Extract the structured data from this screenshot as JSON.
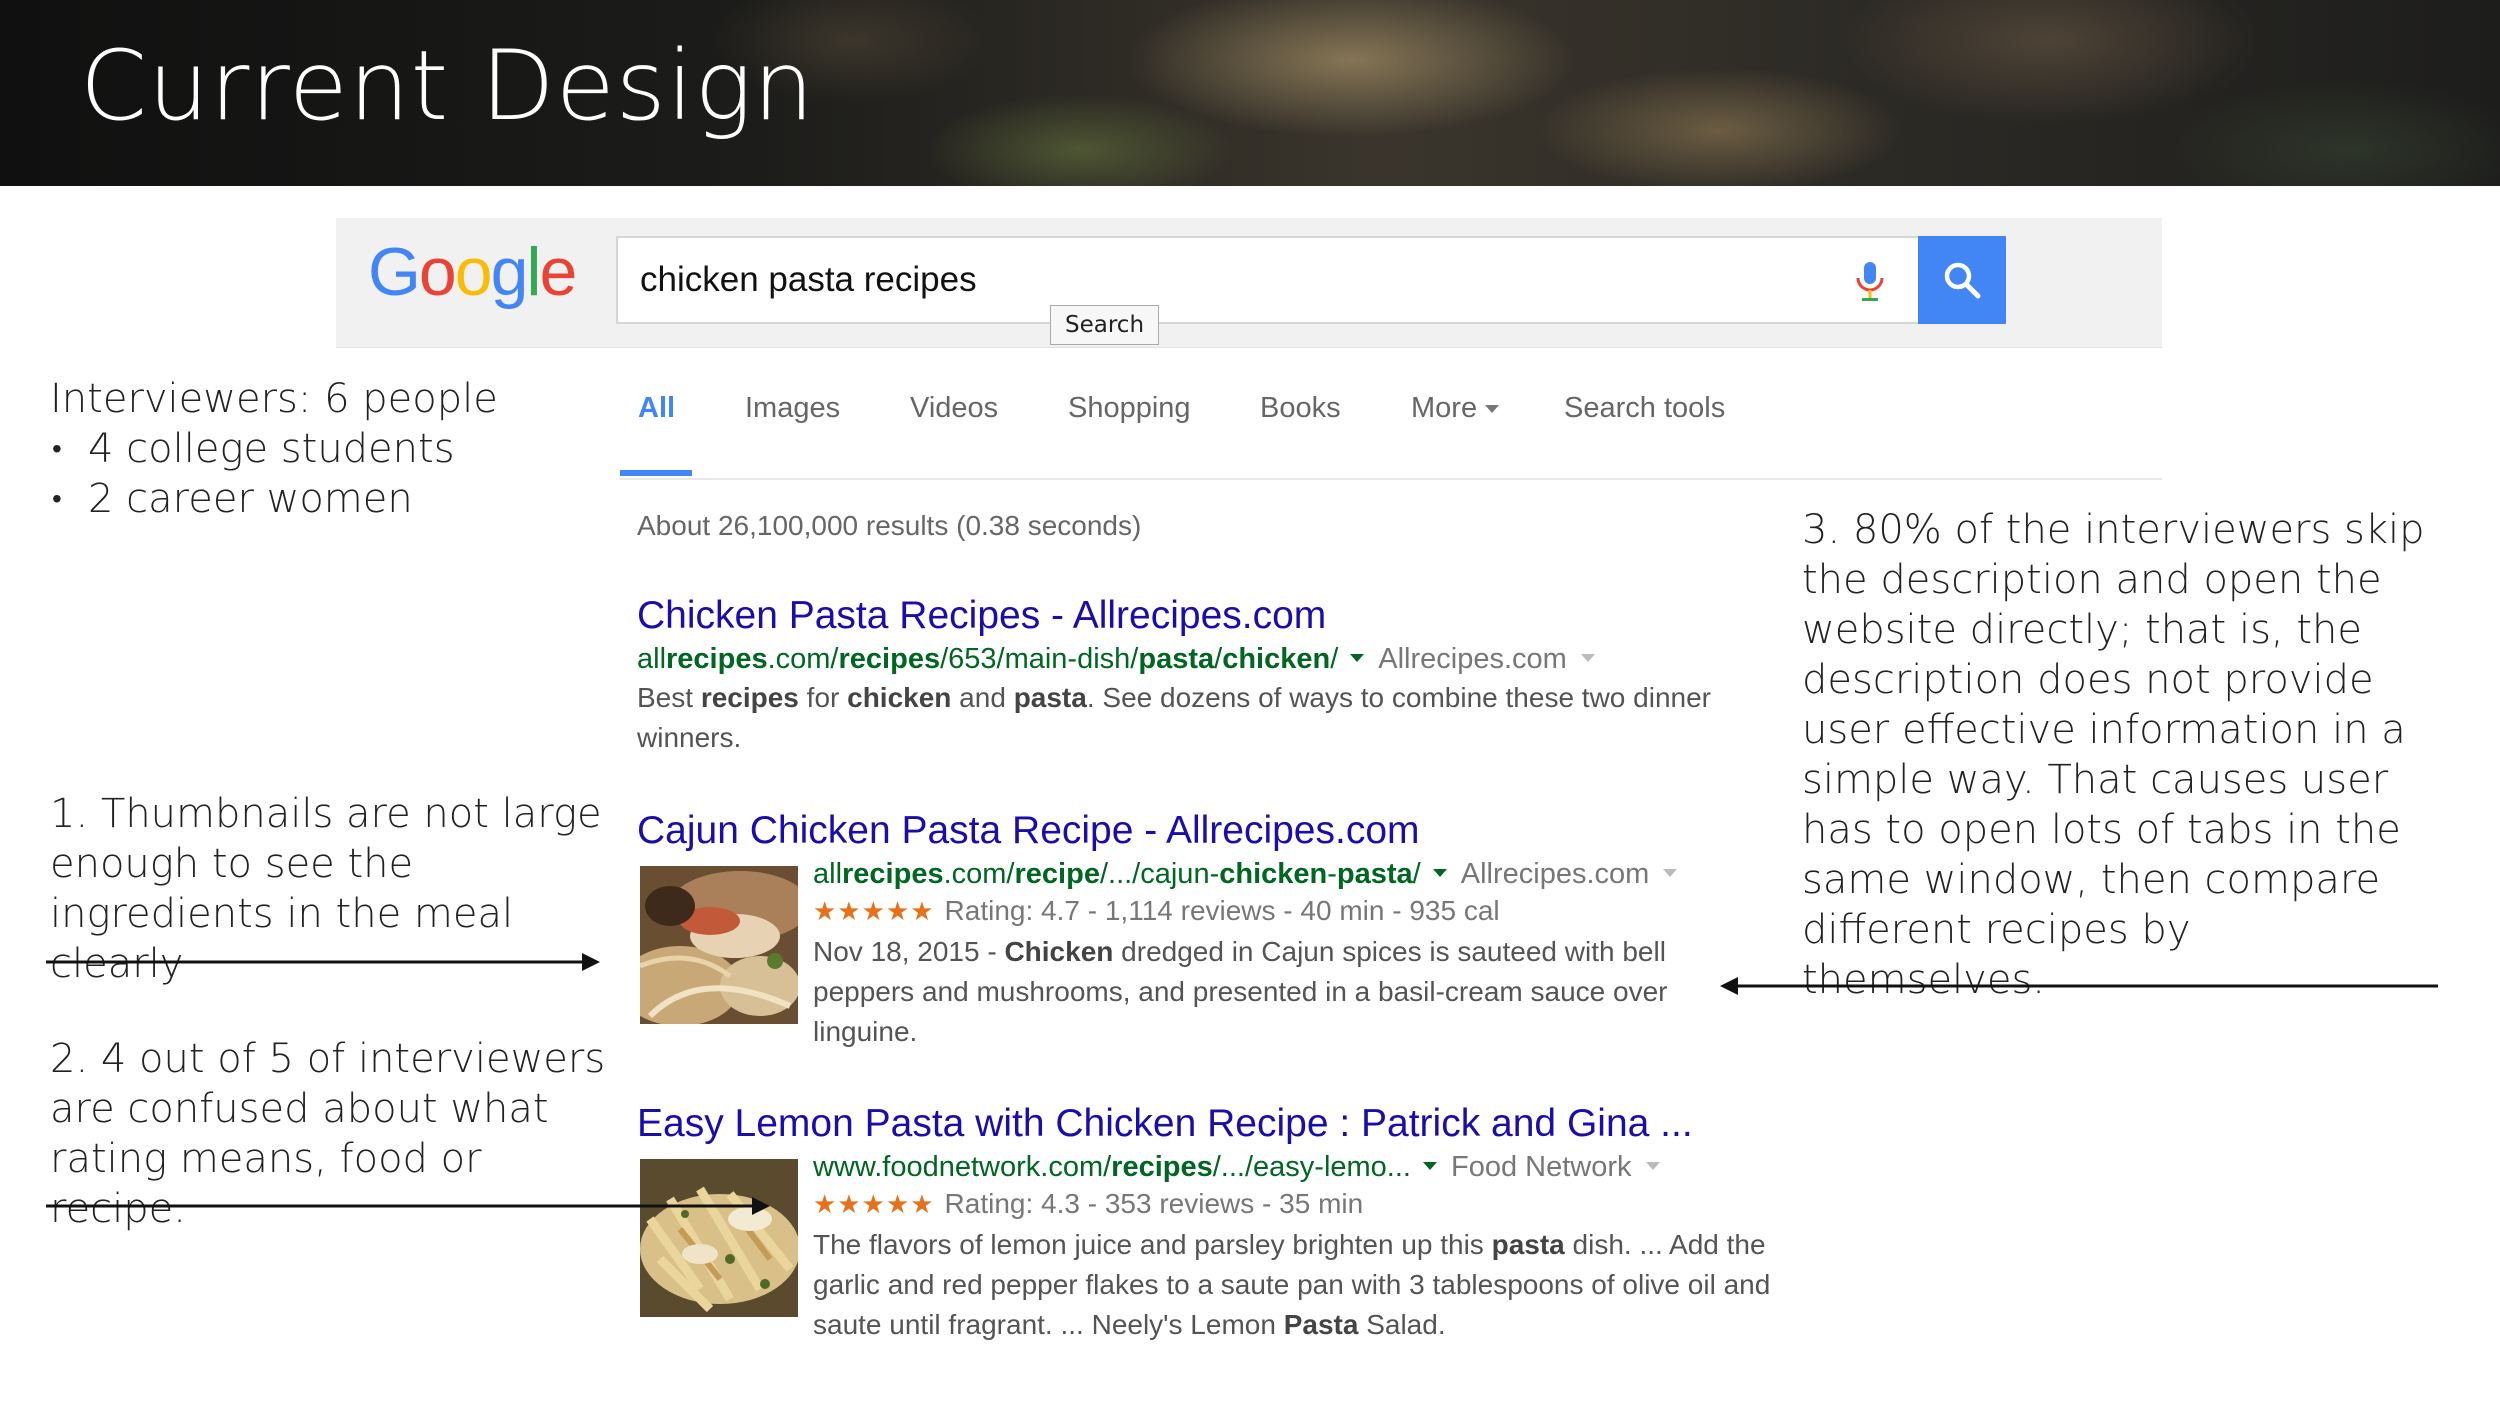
{
  "slide": {
    "title": "Current Design"
  },
  "google": {
    "logo": [
      "G",
      "o",
      "o",
      "g",
      "l",
      "e"
    ],
    "query": "chicken pasta recipes",
    "search_tooltip": "Search",
    "icons": {
      "mic": "mic-icon",
      "search": "search-icon"
    },
    "colors": {
      "blue": "#4285f4",
      "red": "#ea4335",
      "yellow": "#fbbc05",
      "green": "#34a853",
      "link": "#1a0dab",
      "url": "#006621",
      "stars": "#e7711b"
    }
  },
  "tabs": [
    {
      "label": "All",
      "active": true
    },
    {
      "label": "Images",
      "active": false
    },
    {
      "label": "Videos",
      "active": false
    },
    {
      "label": "Shopping",
      "active": false
    },
    {
      "label": "Books",
      "active": false
    },
    {
      "label": "More",
      "active": false
    },
    {
      "label": "Search tools",
      "active": false
    }
  ],
  "result_stats": "About 26,100,000 results (0.38 seconds)",
  "results": [
    {
      "title": "Chicken Pasta Recipes - Allrecipes.com",
      "url_pre": "all",
      "url_bold1": "recipes",
      "url_mid": ".com/",
      "url_bold2": "recipes",
      "url_rest": "/653/main-dish/",
      "url_bold3": "pasta",
      "url_sep": "/",
      "url_bold4": "chicken",
      "url_end": "/",
      "site": "Allrecipes.com",
      "desc": [
        {
          "t": "Best ",
          "b": false
        },
        {
          "t": "recipes",
          "b": true
        },
        {
          "t": " for ",
          "b": false
        },
        {
          "t": "chicken",
          "b": true
        },
        {
          "t": " and ",
          "b": false
        },
        {
          "t": "pasta",
          "b": true
        },
        {
          "t": ". See dozens of ways to combine these two dinner winners.",
          "b": false
        }
      ]
    },
    {
      "title": "Cajun Chicken Pasta Recipe - Allrecipes.com",
      "url_pre": "all",
      "url_bold1": "recipes",
      "url_mid": ".com/",
      "url_bold2": "recipe",
      "url_rest": "/.../cajun-",
      "url_bold3": "chicken",
      "url_sep": "-",
      "url_bold4": "pasta",
      "url_end": "/",
      "site": "Allrecipes.com",
      "stars": "★★★★★",
      "rating": "Rating: 4.7 - 1,114 reviews - 40 min - 935 cal",
      "rating_value": 4.7,
      "desc": [
        {
          "t": "Nov 18, 2015 - ",
          "b": false
        },
        {
          "t": "Chicken",
          "b": true
        },
        {
          "t": " dredged in Cajun spices is sauteed with bell peppers and mushrooms, and presented in a basil-cream sauce over linguine.",
          "b": false
        }
      ]
    },
    {
      "title": "Easy Lemon Pasta with Chicken Recipe : Patrick and Gina ...",
      "url_pre": "www.foodnetwork.com/",
      "url_bold1": "recipes",
      "url_mid": "/.../easy-lemo...",
      "site": "Food Network",
      "stars": "★★★★★",
      "rating": "Rating: 4.3 - 353 reviews - 35 min",
      "rating_value": 4.3,
      "desc": [
        {
          "t": "The flavors of lemon juice and parsley brighten up this ",
          "b": false
        },
        {
          "t": "pasta",
          "b": true
        },
        {
          "t": " dish. ... Add the garlic and red pepper flakes to a saute pan with 3 tablespoons of olive oil and saute until fragrant. ... Neely's Lemon ",
          "b": false
        },
        {
          "t": "Pasta",
          "b": true
        },
        {
          "t": " Salad.",
          "b": false
        }
      ]
    }
  ],
  "notes": {
    "interviewers": {
      "heading": "Interviewers: 6 people",
      "items": [
        "4 college students",
        "2 career women"
      ]
    },
    "note1": "1. Thumbnails are not large enough to see the ingredients in the meal clearly",
    "note2": "2. 4 out of 5 of interviewers are confused about what rating means, food or recipe.",
    "note3": "3. 80% of the interviewers skip the description and open the website directly; that is, the description does not provide user effective information in a simple way. That causes user has to open lots of tabs in the same window, then compare different recipes by themselves."
  }
}
